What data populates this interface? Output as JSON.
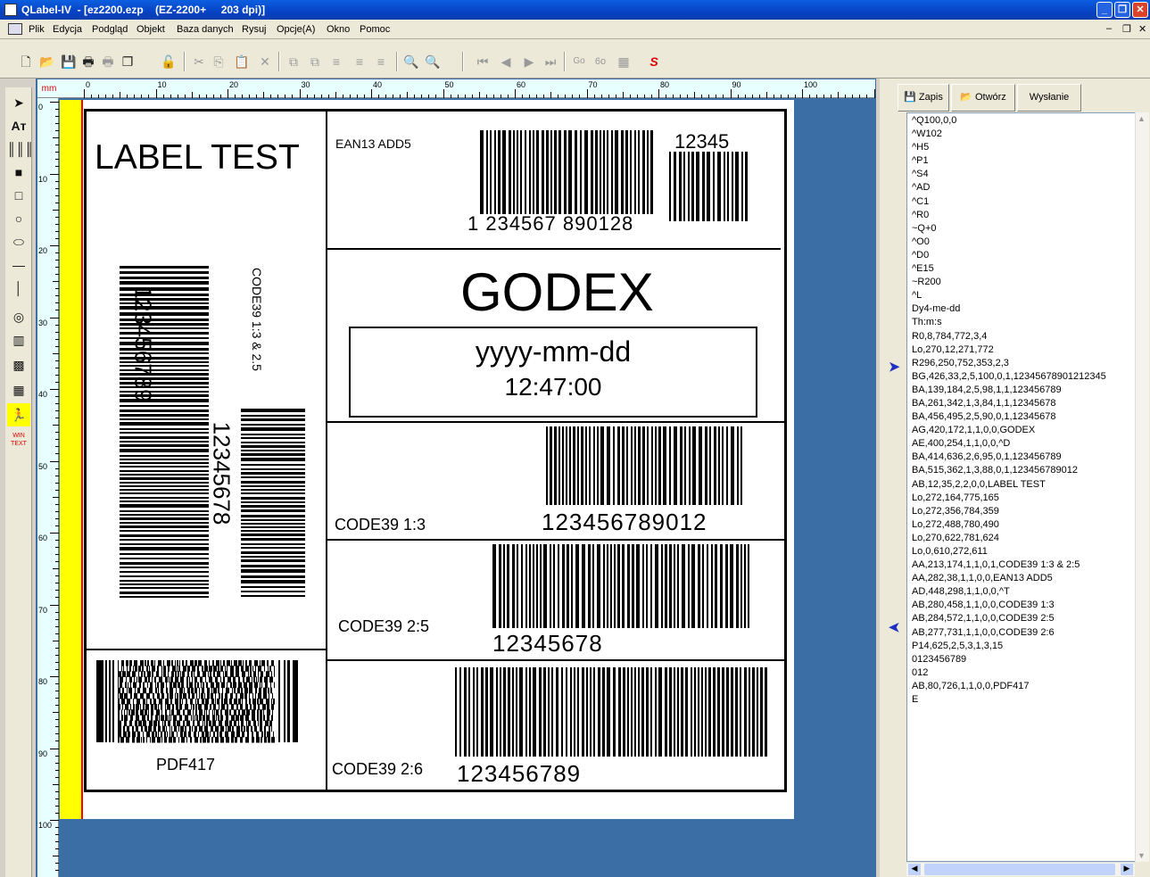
{
  "window": {
    "title": "QLabel-IV  - [ez2200.ezp    (EZ-2200+     203 dpi)]"
  },
  "menu": [
    "Plik",
    "Edycja",
    "Podgląd",
    "Objekt",
    "Baza danych",
    "Rysuj",
    "Opcje(A)",
    "Okno",
    "Pomoc"
  ],
  "toolbar": {
    "go": "Go"
  },
  "ruler": {
    "unit": "mm",
    "h_ticks": [
      "0",
      "10",
      "20",
      "30",
      "40",
      "50",
      "60",
      "70",
      "80",
      "90",
      "100"
    ],
    "v_ticks": [
      "0",
      "10",
      "20",
      "30",
      "40",
      "50",
      "60",
      "70",
      "80",
      "90",
      "100"
    ]
  },
  "label": {
    "title": "LABEL TEST",
    "ean_caption": "EAN13 ADD5",
    "ean_digits": "1 234567 890128",
    "ean_add": "12345",
    "code39_v1": "123456789",
    "code39_v_caption": "CODE39 1:3 & 2.5",
    "code39_v2": "12345678",
    "godex": "GODEX",
    "date": "yyyy-mm-dd",
    "time": "12:47:00",
    "c39_13_caption": "CODE39 1:3",
    "c39_13_digits": "123456789012",
    "c39_25_caption": "CODE39 2:5",
    "c39_25_digits": "12345678",
    "c39_26_caption": "CODE39 2:6",
    "c39_26_digits": "123456789",
    "pdf_caption": "PDF417"
  },
  "rightpane": {
    "save": "Zapis",
    "open": "Otwórz",
    "send": "Wysłanie",
    "code": [
      "^Q100,0,0",
      "^W102",
      "^H5",
      "^P1",
      "^S4",
      "^AD",
      "^C1",
      "^R0",
      "~Q+0",
      "^O0",
      "^D0",
      "^E15",
      "~R200",
      "^L",
      "Dy4-me-dd",
      "Th:m:s",
      "R0,8,784,772,3,4",
      "Lo,270,12,271,772",
      "R296,250,752,353,2,3",
      "BG,426,33,2,5,100,0,1,12345678901212345",
      "BA,139,184,2,5,98,1,1,123456789",
      "BA,261,342,1,3,84,1,1,12345678",
      "BA,456,495,2,5,90,0,1,12345678",
      "AG,420,172,1,1,0,0,GODEX",
      "AE,400,254,1,1,0,0,^D",
      "BA,414,636,2,6,95,0,1,123456789",
      "BA,515,362,1,3,88,0,1,123456789012",
      "AB,12,35,2,2,0,0,LABEL TEST",
      "Lo,272,164,775,165",
      "Lo,272,356,784,359",
      "Lo,272,488,780,490",
      "Lo,270,622,781,624",
      "Lo,0,610,272,611",
      "AA,213,174,1,1,0,1,CODE39 1:3 & 2:5",
      "AA,282,38,1,1,0,0,EAN13 ADD5",
      "AD,448,298,1,1,0,0,^T",
      "AB,280,458,1,1,0,0,CODE39 1:3",
      "AB,284,572,1,1,0,0,CODE39 2:5",
      "AB,277,731,1,1,0,0,CODE39 2:6",
      "P14,625,2,5,3,1,3,15",
      "0123456789",
      "012",
      "AB,80,726,1,1,0,0,PDF417",
      "E"
    ]
  },
  "colors": {
    "titlebar": "#0842c4",
    "workspace": "#3a6ea5",
    "ruler": "#e7ffff",
    "margin": "#ffff00"
  }
}
